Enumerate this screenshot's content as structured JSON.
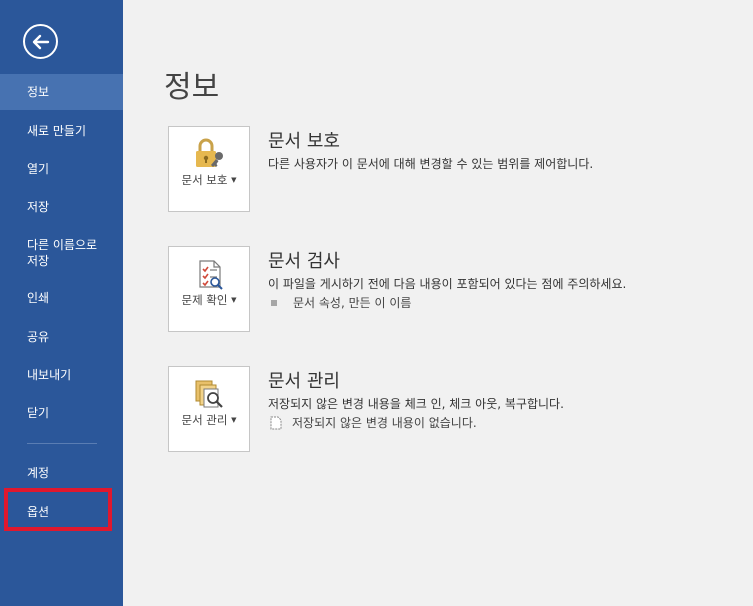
{
  "sidebar": {
    "items": [
      {
        "label": "정보"
      },
      {
        "label": "새로 만들기"
      },
      {
        "label": "열기"
      },
      {
        "label": "저장"
      },
      {
        "label": "다른 이름으로\n저장"
      },
      {
        "label": "인쇄"
      },
      {
        "label": "공유"
      },
      {
        "label": "내보내기"
      },
      {
        "label": "닫기"
      },
      {
        "label": "계정"
      },
      {
        "label": "옵션"
      }
    ],
    "active_index": 0,
    "highlight_color": "#e0182e"
  },
  "main": {
    "title": "정보",
    "sections": [
      {
        "button_label": "문서 보호",
        "title": "문서 보호",
        "description": "다른 사용자가 이 문서에 대해 변경할 수 있는 범위를 제어합니다.",
        "icon": "lock-icon"
      },
      {
        "button_label": "문제 확인",
        "title": "문서 검사",
        "description": "이 파일을 게시하기 전에 다음 내용이 포함되어 있다는 점에 주의하세요.",
        "sub_item": "문서 속성, 만든 이 이름",
        "icon": "inspect-icon"
      },
      {
        "button_label": "문서 관리",
        "title": "문서 관리",
        "description": "저장되지 않은 변경 내용을 체크 인, 체크 아웃, 복구합니다.",
        "sub_item": "저장되지 않은 변경 내용이 없습니다.",
        "icon": "manage-versions-icon"
      }
    ]
  },
  "colors": {
    "sidebar_bg": "#2b579a",
    "sidebar_active": "#4772b1",
    "page_bg": "#f1f1f1"
  }
}
